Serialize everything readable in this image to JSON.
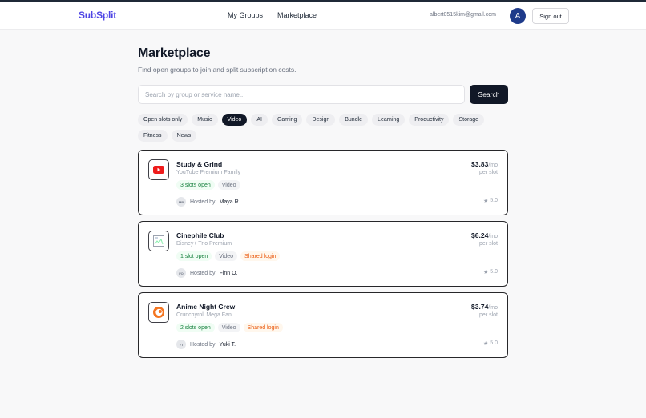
{
  "header": {
    "logo": "SubSplit",
    "nav": [
      "My Groups",
      "Marketplace"
    ],
    "user_email": "albert0515kim@gmail.com",
    "avatar_initial": "A",
    "signout_label": "Sign out"
  },
  "main": {
    "title": "Marketplace",
    "subtitle": "Find open groups to join and split subscription costs.",
    "search": {
      "placeholder": "Search by group or service name...",
      "button_label": "Search"
    },
    "filters": [
      {
        "label": "Open slots only",
        "active": false
      },
      {
        "label": "Music",
        "active": false
      },
      {
        "label": "Video",
        "active": true
      },
      {
        "label": "AI",
        "active": false
      },
      {
        "label": "Gaming",
        "active": false
      },
      {
        "label": "Design",
        "active": false
      },
      {
        "label": "Bundle",
        "active": false
      },
      {
        "label": "Learning",
        "active": false
      },
      {
        "label": "Productivity",
        "active": false
      },
      {
        "label": "Storage",
        "active": false
      },
      {
        "label": "Fitness",
        "active": false
      },
      {
        "label": "News",
        "active": false
      }
    ]
  },
  "groups": [
    {
      "icon": "youtube-icon",
      "name": "Study & Grind",
      "service": "YouTube Premium Family",
      "slots": "3 slots open",
      "category": "Video",
      "shared": "",
      "host_prefix": "Hosted by",
      "host_initials": "MR",
      "host_name": "Maya R.",
      "price": "$3.83",
      "price_unit": "/mo",
      "per_slot": "per slot",
      "rating": "5.0"
    },
    {
      "icon": "broken-image-icon",
      "name": "Cinephile Club",
      "service": "Disney+ Trio Premium",
      "slots": "1 slot open",
      "category": "Video",
      "shared": "Shared login",
      "host_prefix": "Hosted by",
      "host_initials": "FO",
      "host_name": "Finn O.",
      "price": "$6.24",
      "price_unit": "/mo",
      "per_slot": "per slot",
      "rating": "5.0"
    },
    {
      "icon": "crunchyroll-icon",
      "name": "Anime Night Crew",
      "service": "Crunchyroll Mega Fan",
      "slots": "2 slots open",
      "category": "Video",
      "shared": "Shared login",
      "host_prefix": "Hosted by",
      "host_initials": "YT",
      "host_name": "Yuki T.",
      "price": "$3.74",
      "price_unit": "/mo",
      "per_slot": "per slot",
      "rating": "5.0"
    }
  ],
  "colors": {
    "brand": "#4f46e5",
    "dark": "#111827",
    "slots_green": "#15803d",
    "shared_orange": "#ea580c",
    "avatar_blue": "#1e3a8a",
    "youtube_red": "#ef1b1b",
    "crunchyroll_orange": "#f47521"
  }
}
